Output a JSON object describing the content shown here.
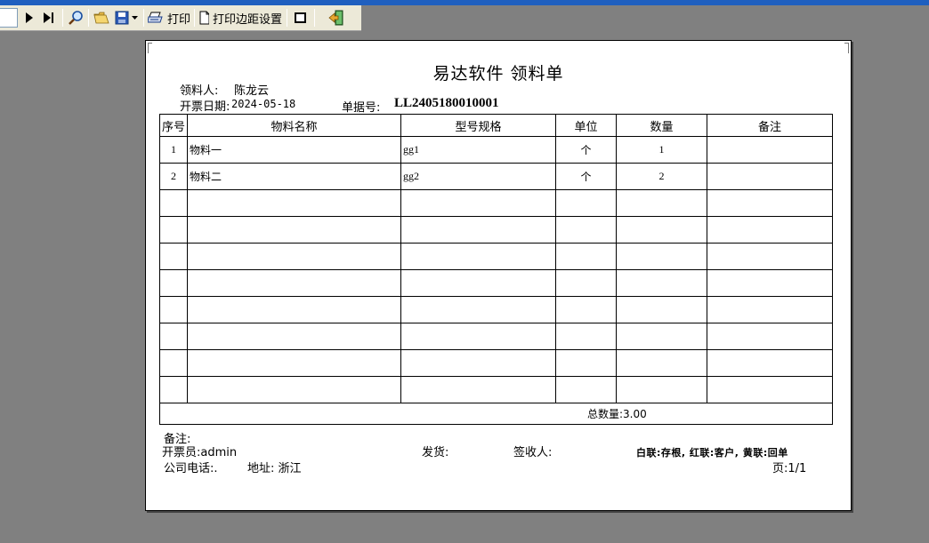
{
  "toolbar": {
    "print_label": "打印",
    "margin_label": "打印边距设置"
  },
  "doc": {
    "title": "易达软件  领料单",
    "recipient_label": "领料人:",
    "recipient_value": "陈龙云",
    "date_label": "开票日期:",
    "date_value": "2024-05-18",
    "docno_label": "单据号:",
    "docno_value": "LL2405180010001"
  },
  "table": {
    "headers": [
      "序号",
      "物料名称",
      "型号规格",
      "单位",
      "数量",
      "备注"
    ],
    "rows": [
      [
        "1",
        "物料一",
        "gg1",
        "个",
        "1",
        ""
      ],
      [
        "2",
        "物料二",
        "gg2",
        "个",
        "2",
        ""
      ],
      [
        "",
        "",
        "",
        "",
        "",
        ""
      ],
      [
        "",
        "",
        "",
        "",
        "",
        ""
      ],
      [
        "",
        "",
        "",
        "",
        "",
        ""
      ],
      [
        "",
        "",
        "",
        "",
        "",
        ""
      ],
      [
        "",
        "",
        "",
        "",
        "",
        ""
      ],
      [
        "",
        "",
        "",
        "",
        "",
        ""
      ],
      [
        "",
        "",
        "",
        "",
        "",
        ""
      ],
      [
        "",
        "",
        "",
        "",
        "",
        ""
      ]
    ],
    "total_label": "总数量:3.00"
  },
  "footer": {
    "remark_label": "备注:",
    "issuer": "开票员:admin",
    "shipper_label": "发货:",
    "receiver_label": "签收人:",
    "copies_note": "白联:存根, 红联:客户, 黄联:回单",
    "phone_label": "公司电话:.",
    "address": "地址: 浙江",
    "page": "页:1/1"
  },
  "icons": [
    "play-icon",
    "last-page-icon",
    "zoom-icon",
    "open-folder-icon",
    "save-icon",
    "dropdown-arrow-icon",
    "printer-icon",
    "page-setup-icon",
    "frame-icon",
    "exit-door-icon"
  ]
}
